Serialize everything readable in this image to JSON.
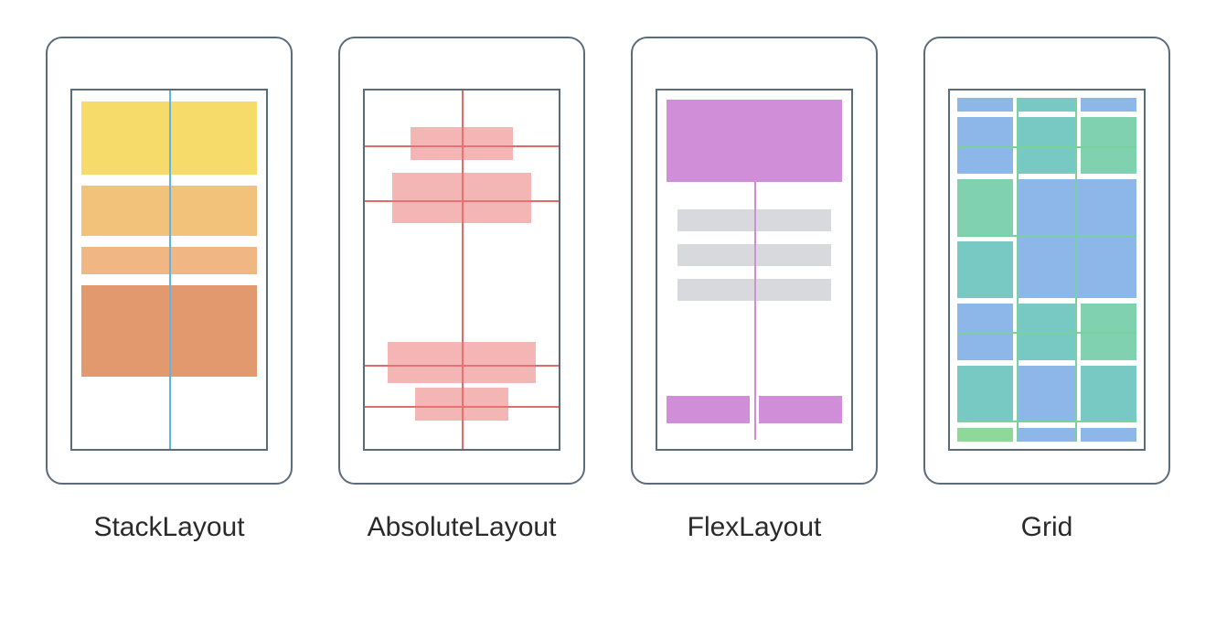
{
  "layouts": {
    "stack": {
      "label": "StackLayout"
    },
    "absolute": {
      "label": "AbsoluteLayout"
    },
    "flex": {
      "label": "FlexLayout"
    },
    "grid": {
      "label": "Grid"
    }
  },
  "colors": {
    "frame": "#5c6b7a",
    "stack_axis": "#5fb3e6",
    "stack_bars": [
      "#f6db6a",
      "#f3c27a",
      "#f0b784",
      "#e2996d"
    ],
    "absolute": "#e46a6a",
    "flex_primary": "#d08ed9",
    "flex_secondary": "#d7d9dd",
    "grid_blue": "#8cb7e8",
    "grid_green": "#7fd1b0",
    "grid_teal": "#78c9c3",
    "grid_line": "#79d29e"
  }
}
